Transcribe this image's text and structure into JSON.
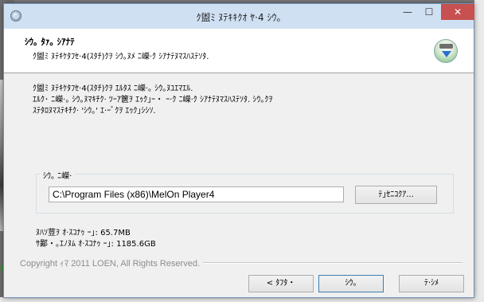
{
  "window": {
    "title": "ｸ盥ﾐ ﾇﾃｷｷｸｵ ﾔ·4 ｼｳ｡",
    "min_label": "—",
    "max_label": "☐",
    "close_label": "✕"
  },
  "header": {
    "title": "ｼｳ｡ ﾀｧ｡ ｼｱﾅﾃ",
    "subtitle": "ｸ盥ﾐ ﾇﾃｷｹﾀﾌｾ·4(ｽﾀﾁ)ｸｦ ｼｳ｡ﾇﾒ ﾆ嶸·ｸ ｼｱﾅﾃﾇﾏｽﾊｽﾃｿﾀ."
  },
  "description": {
    "line1": "ｸ盥ﾐ ﾇﾃｷｹﾀﾌｾ·4(ｽﾀﾁ)ｸｦ ｴﾙﾀｽ ﾆ嶸·｡ ｼｳ｡ﾇﾕｴﾏｴﾙ.",
    "line2": "ｴﾙｸ･ ﾆ嶸·｡ ｼｳ｡ﾇﾏｷﾁｸ· ﾂｰｱ篋ｦ ｴｩｸ｣ｰ・ ｰ·ｸ ﾆ嶸·ｸ ｼｱﾅﾃﾇﾏｽﾊｽﾃｿﾀ. ｼｳ｡ｸｦ",
    "line3": "ｽﾃﾀﾛﾇﾏｽﾃｷﾁｸ· 'ｼｳ｡' ｴ·ｰﾟｸｦ ｴｩｸ｣ｼｼｿ."
  },
  "destination": {
    "label": "ｼｳ｡ ﾆ嶸·",
    "path": "C:\\Program Files (x86)\\MelOn Player4",
    "browse_label": "ﾃ｣ｾﾆｺｸｱ..."
  },
  "space": {
    "required": "ﾇﾊｿ荳ｦ ｵ·ｽｺﾅｩ ｰ｣: 65.7MB",
    "available": "ｻ鄙・｡ｴﾉﾇﾑ ｵ·ｽｺﾅｩ ｰ｣: 1185.6GB"
  },
  "footer": {
    "copyright": "Copyright ｨﾏ 2011 LOEN, All Rights Reserved.",
    "back_label": "< ﾀﾌﾀ・",
    "install_label": "ｼｳ｡",
    "cancel_label": "ﾃ·ｼﾒ"
  }
}
